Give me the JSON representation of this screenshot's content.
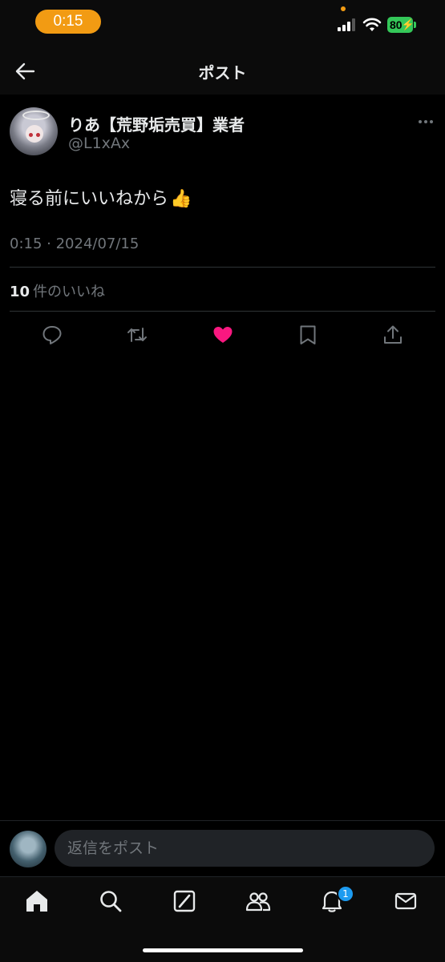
{
  "status_bar": {
    "time": "0:15",
    "battery": "80",
    "accent": "#f29b13",
    "battery_color": "#34c759"
  },
  "header": {
    "title": "ポスト",
    "back_icon": "arrow-left-icon"
  },
  "post": {
    "display_name": "りあ【荒野垢売買】業者",
    "handle": "@L1xAx",
    "text": "寝る前にいいねから",
    "emoji": "👍",
    "meta": "0:15 · 2024/07/15",
    "likes_count": "10",
    "likes_label": "件のいいね"
  },
  "actions": [
    {
      "name": "reply-icon"
    },
    {
      "name": "repost-icon"
    },
    {
      "name": "like-icon",
      "active": true,
      "color": "#f91880"
    },
    {
      "name": "bookmark-icon"
    },
    {
      "name": "share-icon"
    }
  ],
  "reply": {
    "placeholder": "返信をポスト"
  },
  "nav": {
    "items": [
      "home-icon",
      "search-icon",
      "grok-icon",
      "communities-icon",
      "notifications-icon",
      "messages-icon"
    ],
    "notifications_badge": "1",
    "badge_color": "#1d9bf0"
  }
}
